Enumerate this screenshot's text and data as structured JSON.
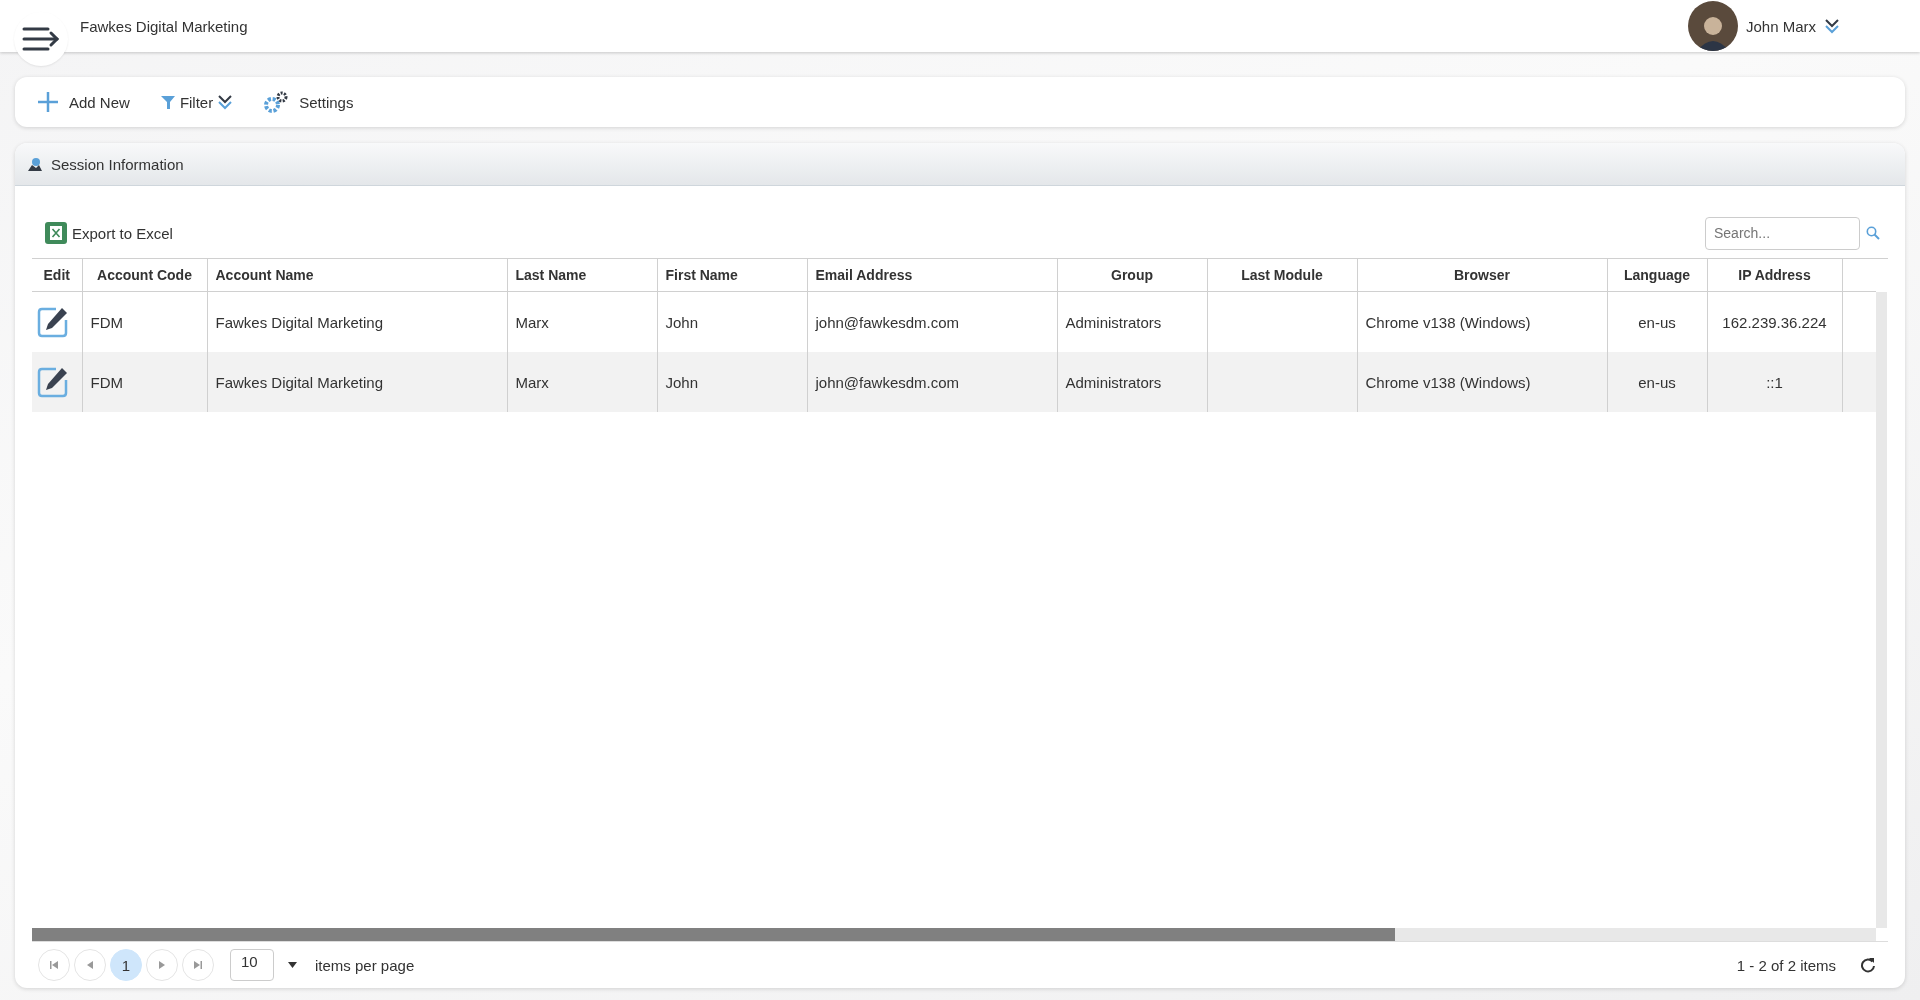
{
  "header": {
    "company": "Fawkes Digital Marketing",
    "user": "John Marx"
  },
  "toolbar": [
    {
      "kind": "add",
      "label": "Add New"
    },
    {
      "kind": "filter",
      "label": "Filter"
    },
    {
      "kind": "settings",
      "label": "Settings"
    }
  ],
  "panel": {
    "title": "Session Information",
    "export_label": "Export to Excel",
    "search": {
      "placeholder": "Search..."
    },
    "table": {
      "columns": [
        "Edit",
        "Account Code",
        "Account Name",
        "Last Name",
        "First Name",
        "Email Address",
        "Group",
        "Last Module",
        "Browser",
        "Language",
        "IP Address"
      ],
      "rows": [
        {
          "cells": [
            "",
            "FDM",
            "Fawkes Digital Marketing",
            "Marx",
            "John",
            "john@fawkesdm.com",
            "Administrators",
            "",
            "Chrome v138 (Windows)",
            "en-us",
            "162.239.36.224"
          ]
        },
        {
          "cells": [
            "",
            "FDM",
            "Fawkes Digital Marketing",
            "Marx",
            "John",
            "john@fawkesdm.com",
            "Administrators",
            "",
            "Chrome v138 (Windows)",
            "en-us",
            "::1"
          ]
        }
      ]
    },
    "pager": {
      "pages": [
        {
          "label": "1",
          "selected": true
        }
      ],
      "page_size": "10",
      "page_size_label": "items per page",
      "summary": "1 - 2 of 2 items"
    }
  }
}
